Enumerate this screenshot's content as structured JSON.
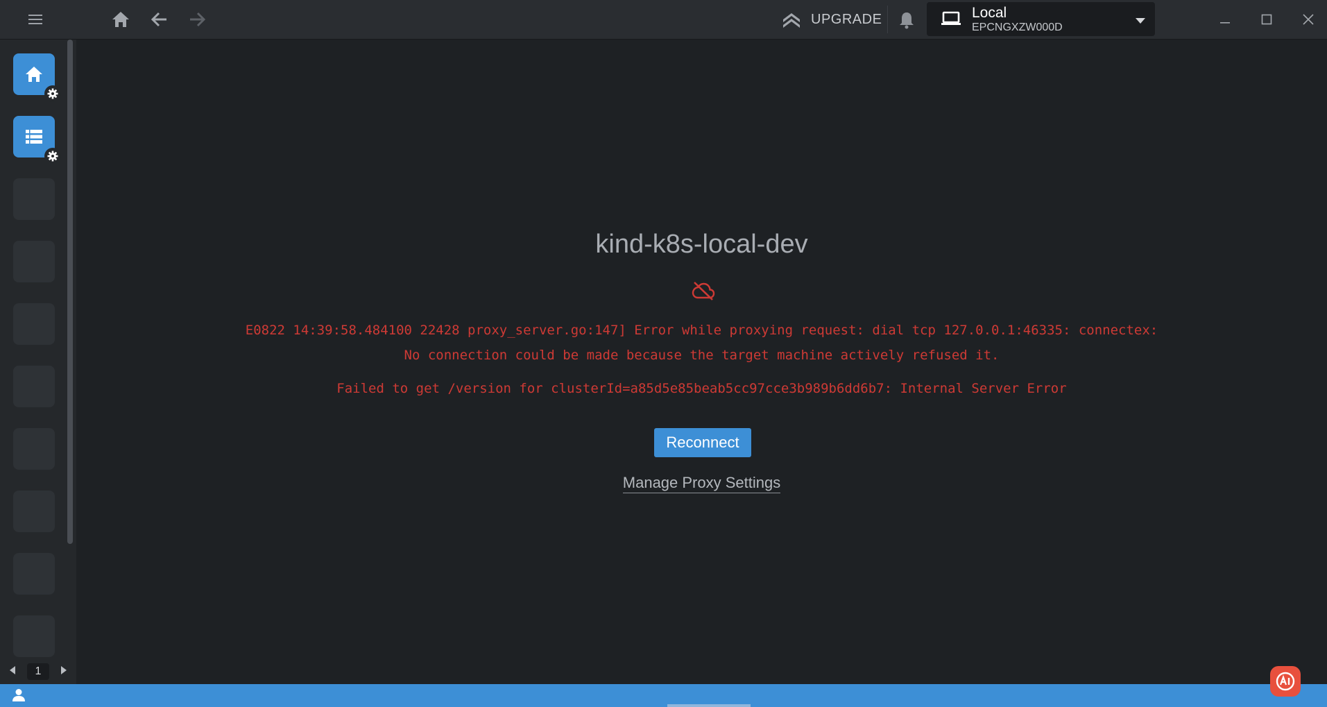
{
  "topbar": {
    "upgrade_label": "UPGRADE",
    "context": {
      "name": "Local",
      "id": "EPCNGXZW000D"
    }
  },
  "rail": {
    "page": "1"
  },
  "main": {
    "cluster_name": "kind-k8s-local-dev",
    "error_line_1": "E0822 14:39:58.484100 22428 proxy_server.go:147] Error while proxying request: dial tcp 127.0.0.1:46335: connectex:",
    "error_line_2": "No connection could be made because the target machine actively refused it.",
    "error_line_3": "Failed to get /version for clusterId=a85d5e85beab5cc97cce3b989b6dd6b7: Internal Server Error",
    "reconnect_label": "Reconnect",
    "proxy_settings_label": "Manage Proxy Settings"
  },
  "colors": {
    "accent": "#3d8fd6",
    "error": "#ce3a35",
    "background": "#1e2124"
  }
}
